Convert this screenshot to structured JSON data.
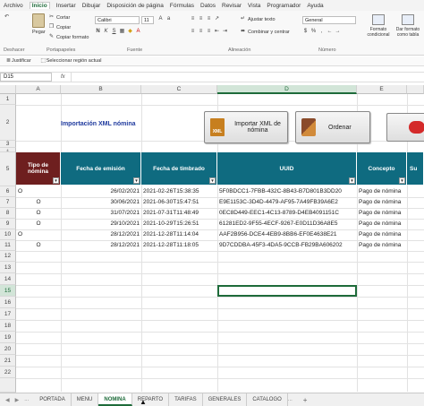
{
  "menu": {
    "tabs": [
      "Archivo",
      "Inicio",
      "Insertar",
      "Dibujar",
      "Disposición de página",
      "Fórmulas",
      "Datos",
      "Revisar",
      "Vista",
      "Programador",
      "Ayuda"
    ],
    "active_index": 1
  },
  "ribbon": {
    "clipboard": {
      "paste": "Pegar",
      "cut": "Cortar",
      "copy": "Copiar",
      "format_painter": "Copiar formato",
      "group": "Portapapeles"
    },
    "undo_group": "Deshacer",
    "font": {
      "name": "Calibri",
      "size": "11",
      "group": "Fuente"
    },
    "alignment": {
      "wrap": "Ajustar texto",
      "merge": "Combinar y centrar",
      "group": "Alineación"
    },
    "number": {
      "format": "General",
      "group": "Número"
    },
    "styles": {
      "conditional": "Formato condicional",
      "table": "Dar formato como tabla"
    }
  },
  "quickbar": {
    "item1": "Justificar",
    "item2": "Seleccionar región actual"
  },
  "formula_bar": {
    "namebox": "D15",
    "fx": "fx",
    "content": ""
  },
  "columns": [
    "A",
    "B",
    "C",
    "D",
    "E"
  ],
  "rows": [
    "1",
    "2",
    "3",
    "4",
    "5",
    "6",
    "7",
    "8",
    "9",
    "10",
    "11",
    "12",
    "13",
    "14",
    "15",
    "16",
    "17",
    "18",
    "19",
    "20",
    "21",
    "22"
  ],
  "selected_row": "15",
  "selected_column": "D",
  "sheet": {
    "title": "Importación XML nómina",
    "import_button": "Importar XML de nómina",
    "sort_button": "Ordenar",
    "xml_icon_text": "XML"
  },
  "table": {
    "headers": [
      "Tipo de nómina",
      "Fecha de emisión",
      "Fecha de timbrado",
      "UUID",
      "Concepto",
      "Su"
    ],
    "filter_glyph": "▾",
    "rows": [
      {
        "tipo": "O",
        "emision": "26/02/2021",
        "timbrado": "2021-02-26T15:38:35",
        "uuid": "5F0BDCC1-7FBB-432C-8B43-B7D801B3DD20",
        "concepto": "Pago de nómina"
      },
      {
        "tipo": "O",
        "emision": "30/06/2021",
        "timbrado": "2021-06-30T15:47:51",
        "uuid": "E9E1153C-3D4D-4479-AF95-7A49FB39A6E2",
        "concepto": "Pago de nómina"
      },
      {
        "tipo": "O",
        "emision": "31/07/2021",
        "timbrado": "2021-07-31T11:48:49",
        "uuid": "0EC8D449-EEC1-4C13-8789-D4EB4091151C",
        "concepto": "Pago de nómina"
      },
      {
        "tipo": "O",
        "emision": "29/10/2021",
        "timbrado": "2021-10-29T15:26:51",
        "uuid": "61281ED2-9F55-4ECF-9267-E0D11D36A8E5",
        "concepto": "Pago de nómina"
      },
      {
        "tipo": "O",
        "emision": "28/12/2021",
        "timbrado": "2021-12-28T11:14:04",
        "uuid": "AAF2B956-DCE4-4EB9-8BB6-EF0E4638E21",
        "concepto": "Pago de nómina"
      },
      {
        "tipo": "O",
        "emision": "28/12/2021",
        "timbrado": "2021-12-28T11:18:05",
        "uuid": "9D7CDDBA-45F3-4DA5-9CCB-FB29BA606202",
        "concepto": "Pago de nómina"
      }
    ]
  },
  "sheet_tabs": [
    "PORTADA",
    "MENU",
    "NOMINA",
    "REPARTO",
    "TARIFAS",
    "GENERALES",
    "CATALOGO"
  ],
  "active_sheet": "NOMINA",
  "add_sheet": "+",
  "nav": {
    "prev": "◀",
    "next": "▶",
    "more": "..."
  },
  "colors": {
    "accent": "#1e6b3a",
    "header_teal": "#0f6b80",
    "header_first": "#6e1f1f",
    "title_blue": "#1f3a9e"
  }
}
